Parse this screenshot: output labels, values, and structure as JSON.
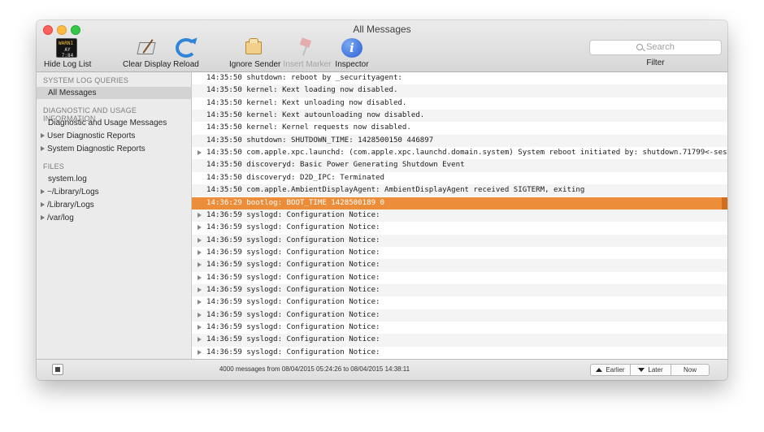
{
  "window": {
    "title": "All Messages"
  },
  "toolbar": {
    "hide_log_list": "Hide Log List",
    "console_icon_line1": "WARNI",
    "console_icon_line2": "AY 7:84",
    "clear_display": "Clear Display",
    "reload": "Reload",
    "ignore_sender": "Ignore Sender",
    "insert_marker": "Insert Marker",
    "inspector": "Inspector",
    "inspector_glyph": "i",
    "search_placeholder": "Search",
    "filter_label": "Filter"
  },
  "sidebar": {
    "system_log_queries": {
      "header": "SYSTEM LOG QUERIES",
      "items": [
        {
          "label": "All Messages",
          "selected": true
        }
      ]
    },
    "diagnostic": {
      "header": "DIAGNOSTIC AND USAGE INFORMATION",
      "items": [
        {
          "label": "Diagnostic and Usage Messages",
          "expandable": false
        },
        {
          "label": "User Diagnostic Reports",
          "expandable": true
        },
        {
          "label": "System Diagnostic Reports",
          "expandable": true
        }
      ]
    },
    "files": {
      "header": "FILES",
      "items": [
        {
          "label": "system.log",
          "expandable": false
        },
        {
          "label": "~/Library/Logs",
          "expandable": true
        },
        {
          "label": "/Library/Logs",
          "expandable": true
        },
        {
          "label": "/var/log",
          "expandable": true
        }
      ]
    }
  },
  "log": {
    "rows": [
      {
        "text": "14:35:50 shutdown: reboot by _securityagent:",
        "expandable": false,
        "highlighted": false
      },
      {
        "text": "14:35:50 kernel: Kext loading now disabled.",
        "expandable": false,
        "highlighted": false
      },
      {
        "text": "14:35:50 kernel: Kext unloading now disabled.",
        "expandable": false,
        "highlighted": false
      },
      {
        "text": "14:35:50 kernel: Kext autounloading now disabled.",
        "expandable": false,
        "highlighted": false
      },
      {
        "text": "14:35:50 kernel: Kernel requests now disabled.",
        "expandable": false,
        "highlighted": false
      },
      {
        "text": "14:35:50 shutdown: SHUTDOWN_TIME: 1428500150 446897",
        "expandable": false,
        "highlighted": false
      },
      {
        "text": "14:35:50 com.apple.xpc.launchd: (com.apple.xpc.launchd.domain.system) System reboot initiated by: shutdown.71799<-ses…",
        "expandable": true,
        "highlighted": false
      },
      {
        "text": "14:35:50 discoveryd: Basic Power Generating Shutdown Event",
        "expandable": false,
        "highlighted": false
      },
      {
        "text": "14:35:50 discoveryd: D2D_IPC: Terminated",
        "expandable": false,
        "highlighted": false
      },
      {
        "text": "14:35:50 com.apple.AmbientDisplayAgent: AmbientDisplayAgent received SIGTERM, exiting",
        "expandable": false,
        "highlighted": false
      },
      {
        "text": "14:36:29 bootlog: BOOT_TIME 1428500189 0",
        "expandable": false,
        "highlighted": true
      },
      {
        "text": "14:36:59 syslogd: Configuration Notice:",
        "expandable": true,
        "highlighted": false
      },
      {
        "text": "14:36:59 syslogd: Configuration Notice:",
        "expandable": true,
        "highlighted": false
      },
      {
        "text": "14:36:59 syslogd: Configuration Notice:",
        "expandable": true,
        "highlighted": false
      },
      {
        "text": "14:36:59 syslogd: Configuration Notice:",
        "expandable": true,
        "highlighted": false
      },
      {
        "text": "14:36:59 syslogd: Configuration Notice:",
        "expandable": true,
        "highlighted": false
      },
      {
        "text": "14:36:59 syslogd: Configuration Notice:",
        "expandable": true,
        "highlighted": false
      },
      {
        "text": "14:36:59 syslogd: Configuration Notice:",
        "expandable": true,
        "highlighted": false
      },
      {
        "text": "14:36:59 syslogd: Configuration Notice:",
        "expandable": true,
        "highlighted": false
      },
      {
        "text": "14:36:59 syslogd: Configuration Notice:",
        "expandable": true,
        "highlighted": false
      },
      {
        "text": "14:36:59 syslogd: Configuration Notice:",
        "expandable": true,
        "highlighted": false
      },
      {
        "text": "14:36:59 syslogd: Configuration Notice:",
        "expandable": true,
        "highlighted": false
      },
      {
        "text": "14:36:59 syslogd: Configuration Notice:",
        "expandable": true,
        "highlighted": false
      }
    ]
  },
  "statusbar": {
    "status_text": "4000 messages from 08/04/2015 05:24:26 to 08/04/2015 14:38:11",
    "earlier": "Earlier",
    "later": "Later",
    "now": "Now"
  },
  "colors": {
    "highlight_row": "#ec8d3a",
    "close": "#fc605b",
    "minimize": "#fdbc40",
    "zoom": "#34c84a"
  }
}
